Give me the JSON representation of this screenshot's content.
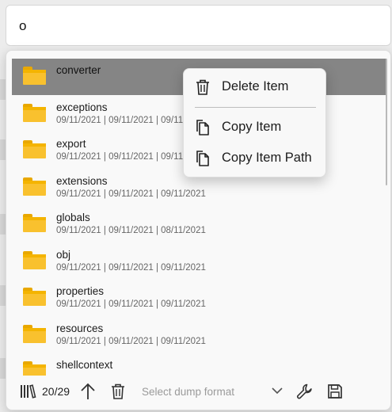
{
  "search": {
    "value": "o",
    "placeholder": ""
  },
  "items": [
    {
      "name": "converter",
      "dates": "",
      "selected": true
    },
    {
      "name": "exceptions",
      "dates": "09/11/2021 | 09/11/2021 | 09/11/2021"
    },
    {
      "name": "export",
      "dates": "09/11/2021 | 09/11/2021 | 09/11/2021"
    },
    {
      "name": "extensions",
      "dates": "09/11/2021 | 09/11/2021 | 09/11/2021"
    },
    {
      "name": "globals",
      "dates": "09/11/2021 | 09/11/2021 | 08/11/2021"
    },
    {
      "name": "obj",
      "dates": "09/11/2021 | 09/11/2021 | 09/11/2021"
    },
    {
      "name": "properties",
      "dates": "09/11/2021 | 09/11/2021 | 09/11/2021"
    },
    {
      "name": "resources",
      "dates": "09/11/2021 | 09/11/2021 | 09/11/2021"
    },
    {
      "name": "shellcontext",
      "dates": ""
    }
  ],
  "context_menu": {
    "delete_label": "Delete Item",
    "copy_label": "Copy Item",
    "copy_path_label": "Copy Item Path"
  },
  "toolbar": {
    "count": "20/29",
    "format_placeholder": "Select dump format"
  },
  "icons": {
    "library": "library-icon",
    "up": "arrow-up-icon",
    "delete": "trash-icon",
    "dropdown": "chevron-down-icon",
    "settings": "wrench-icon",
    "save": "save-icon",
    "folder": "folder-icon",
    "copy": "copy-icon"
  },
  "colors": {
    "selected_row": "#858585",
    "folder": "#f9c12e",
    "folder_dark": "#e9a800"
  }
}
